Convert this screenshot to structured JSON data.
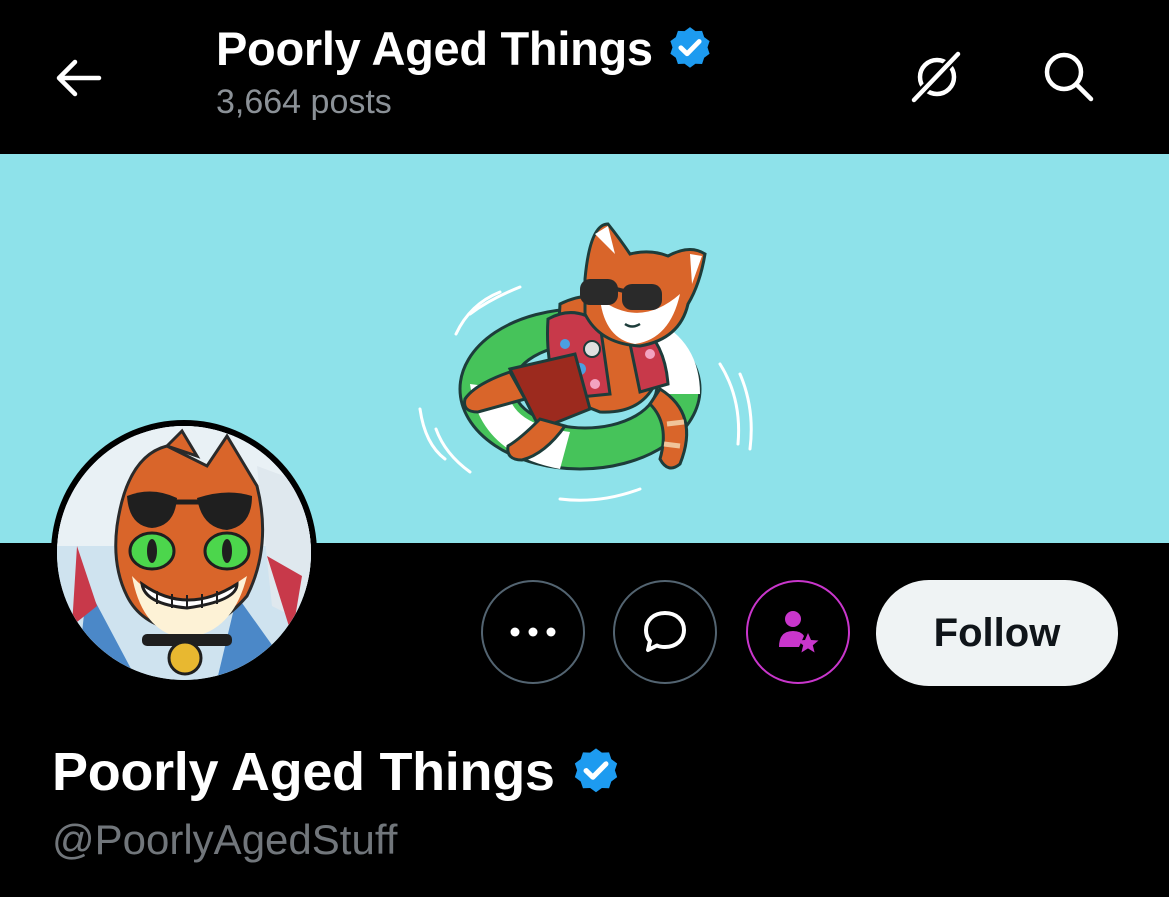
{
  "header": {
    "title": "Poorly Aged Things",
    "post_count": "3,664 posts",
    "verified": true
  },
  "icons": {
    "back": "arrow-left-icon",
    "grok": "grok-slash-icon",
    "search": "search-icon",
    "more": "more-dots-icon",
    "message": "message-bubble-icon",
    "subscribe": "subscribe-person-star-icon",
    "verified": "verified-badge-icon"
  },
  "actions": {
    "follow_label": "Follow"
  },
  "profile": {
    "display_name": "Poorly Aged Things",
    "handle": "@PoorlyAgedStuff",
    "verified": true
  },
  "colors": {
    "background": "#000000",
    "banner": "#8ee2ea",
    "verified_blue": "#1d9bf0",
    "subscribe_purple": "#c936cc",
    "follow_bg": "#eff3f4",
    "muted_text": "#71767b"
  }
}
